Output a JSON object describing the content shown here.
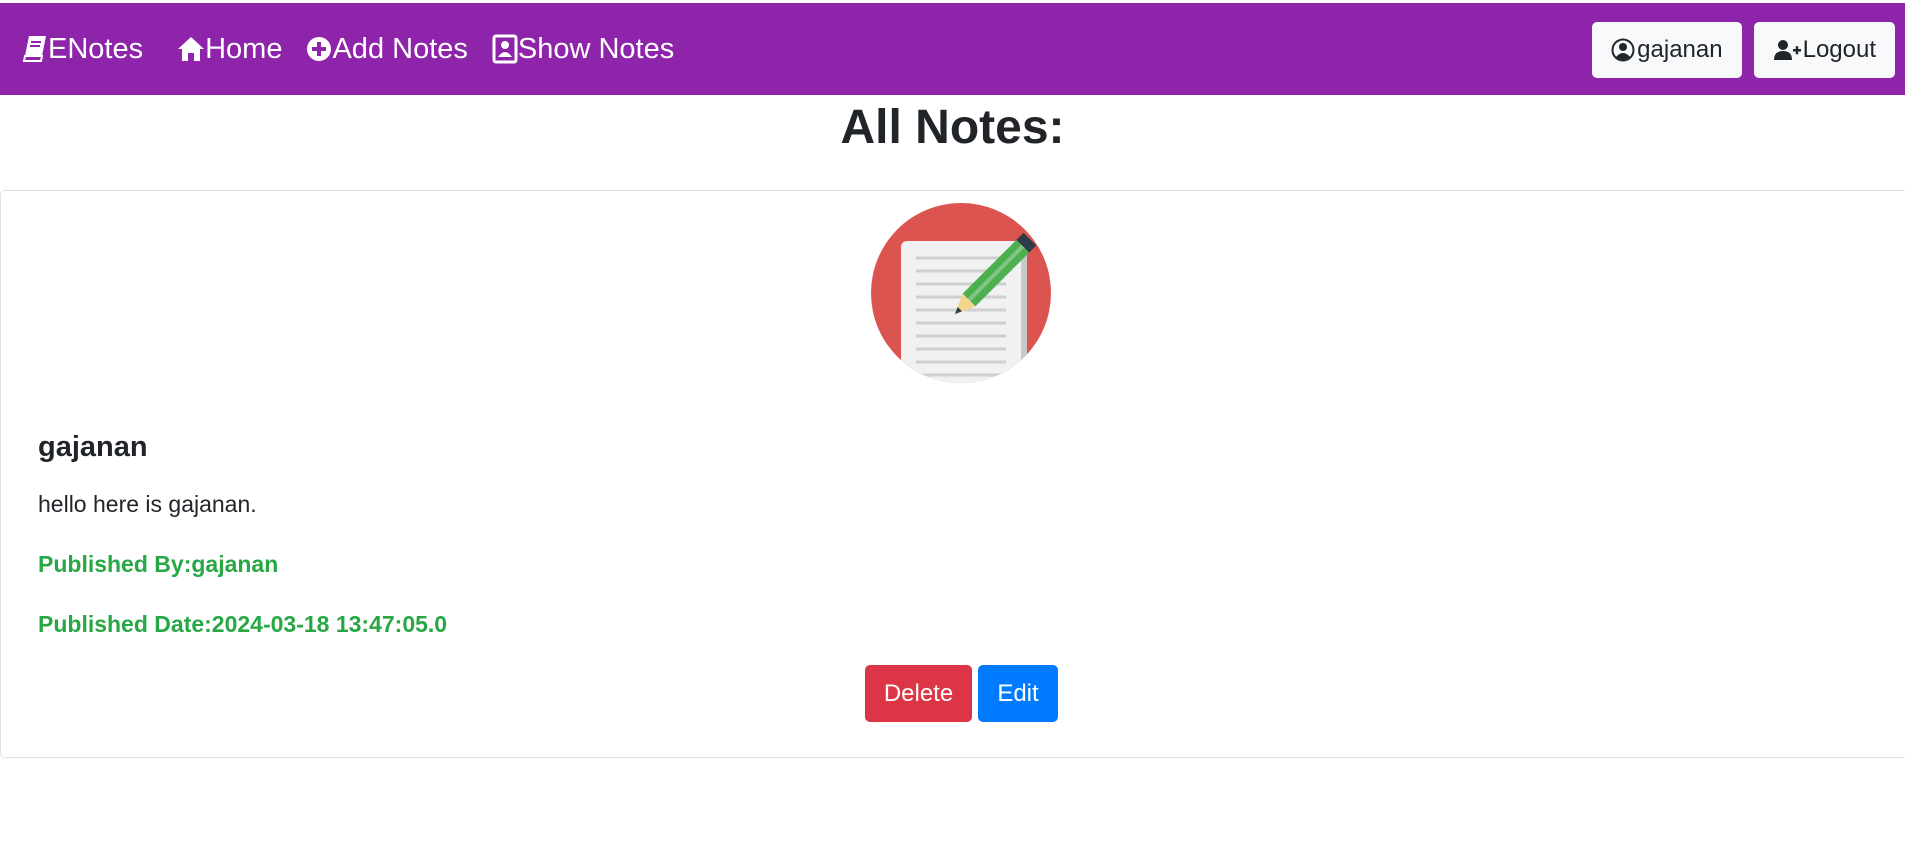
{
  "navbar": {
    "brand": "ENotes",
    "links": [
      {
        "label": "Home",
        "icon": "home-icon"
      },
      {
        "label": "Add Notes",
        "icon": "plus-circle-icon"
      },
      {
        "label": "Show Notes",
        "icon": "address-book-icon"
      }
    ],
    "user_label": "gajanan",
    "logout_label": "Logout"
  },
  "page": {
    "title": "All Notes:"
  },
  "note": {
    "title": "gajanan",
    "content": "hello here is gajanan.",
    "published_by": "Published By:gajanan",
    "published_date": "Published Date:2024-03-18 13:47:05.0",
    "delete_label": "Delete",
    "edit_label": "Edit"
  },
  "colors": {
    "navbar": "#8e24aa",
    "meta_text": "#28a745",
    "delete": "#dc3545",
    "edit": "#007bff",
    "note_icon_bg": "#db5450"
  }
}
